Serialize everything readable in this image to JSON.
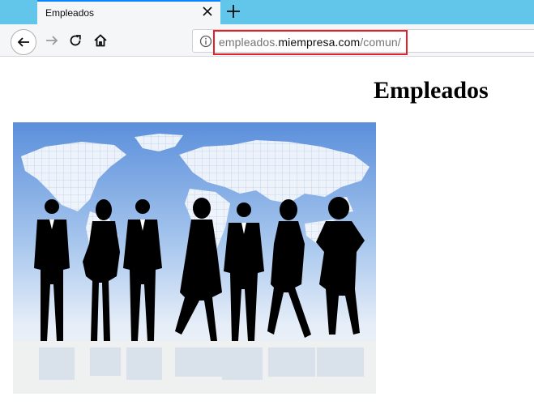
{
  "browser": {
    "tab": {
      "title": "Empleados"
    },
    "url": {
      "domain_prefix": "empleados.",
      "domain": "miempresa.com",
      "path": "/comun/"
    }
  },
  "page": {
    "heading": "Empleados",
    "image": {
      "subject": "employees-silhouettes-world-map"
    }
  },
  "icons": {
    "close": "close-icon",
    "new_tab": "plus-icon",
    "back": "arrow-left-icon",
    "forward": "arrow-right-icon",
    "reload": "reload-icon",
    "home": "home-icon",
    "info": "info-icon"
  },
  "colors": {
    "tabstrip": "#62c5ea",
    "url_highlight": "#e0202a",
    "active_tab_border": "#0a84ff"
  }
}
